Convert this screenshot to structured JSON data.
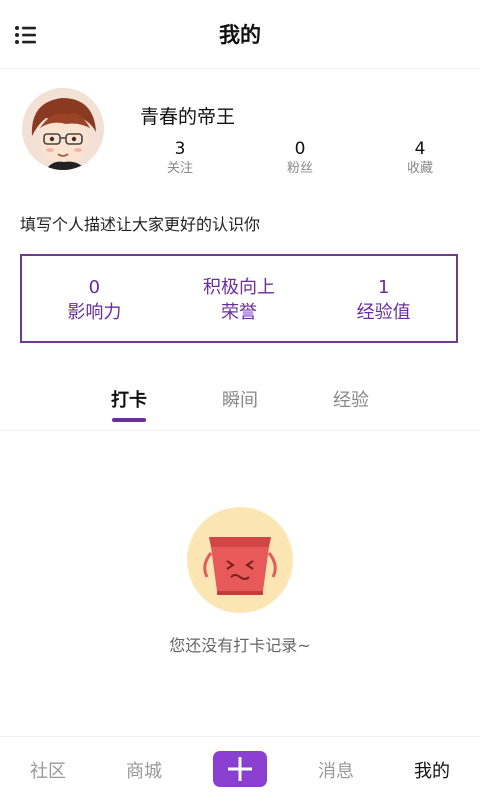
{
  "header": {
    "title": "我的",
    "menu_icon": "list-menu-icon"
  },
  "profile": {
    "username": "青春的帝王",
    "avatar_icon": "cartoon-avatar",
    "stats": [
      {
        "value": "3",
        "label": "关注"
      },
      {
        "value": "0",
        "label": "粉丝"
      },
      {
        "value": "4",
        "label": "收藏"
      }
    ],
    "bio": "填写个人描述让大家更好的认识你"
  },
  "honors": [
    {
      "value": "0",
      "label": "影响力"
    },
    {
      "value": "积极向上",
      "label": "荣誉"
    },
    {
      "value": "1",
      "label": "经验值"
    }
  ],
  "tabs": [
    {
      "label": "打卡",
      "active": true
    },
    {
      "label": "瞬间",
      "active": false
    },
    {
      "label": "经验",
      "active": false
    }
  ],
  "empty_state": {
    "icon": "empty-box-icon",
    "text": "您还没有打卡记录~"
  },
  "bottom_nav": {
    "items": [
      {
        "label": "社区"
      },
      {
        "label": "商城"
      },
      {
        "label": "消息"
      },
      {
        "label": "我的",
        "active": true
      }
    ],
    "add_icon": "plus-icon"
  },
  "colors": {
    "accent": "#6b2d9c",
    "add_button": "#8a3fd1",
    "empty_circle": "#fbe5b2",
    "box_red": "#e85a5a"
  }
}
